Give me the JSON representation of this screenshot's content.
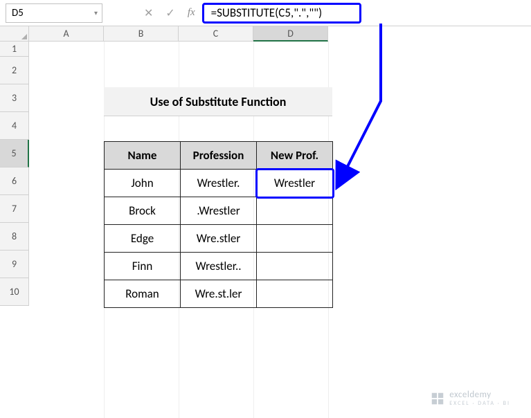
{
  "name_box": "D5",
  "formula": "=SUBSTITUTE(C5,\".\",\"\")",
  "columns": [
    "A",
    "B",
    "C",
    "D"
  ],
  "row_numbers": [
    "1",
    "2",
    "3",
    "4",
    "5",
    "6",
    "7",
    "8",
    "9",
    "10"
  ],
  "active_column": "D",
  "active_row": "5",
  "title": "Use of Substitute Function",
  "headers": {
    "name": "Name",
    "profession": "Profession",
    "newprof": "New Prof."
  },
  "data_rows": [
    {
      "name": "John",
      "profession": "Wrestler.",
      "newprof": "Wrestler"
    },
    {
      "name": "Brock",
      "profession": ".Wrestler",
      "newprof": ""
    },
    {
      "name": "Edge",
      "profession": "Wre.stler",
      "newprof": ""
    },
    {
      "name": "Finn",
      "profession": "Wrestler..",
      "newprof": ""
    },
    {
      "name": "Roman",
      "profession": "Wre.st.ler",
      "newprof": ""
    }
  ],
  "watermark": {
    "brand": "exceldemy",
    "tagline": "EXCEL · DATA · BI"
  },
  "chart_data": {
    "type": "table",
    "title": "Use of Substitute Function",
    "columns": [
      "Name",
      "Profession",
      "New Prof."
    ],
    "rows": [
      [
        "John",
        "Wrestler.",
        "Wrestler"
      ],
      [
        "Brock",
        ".Wrestler",
        ""
      ],
      [
        "Edge",
        "Wre.stler",
        ""
      ],
      [
        "Finn",
        "Wrestler..",
        ""
      ],
      [
        "Roman",
        "Wre.st.ler",
        ""
      ]
    ],
    "highlighted_formula": "=SUBSTITUTE(C5,\".\",\"\")",
    "highlighted_cell": "D5"
  }
}
